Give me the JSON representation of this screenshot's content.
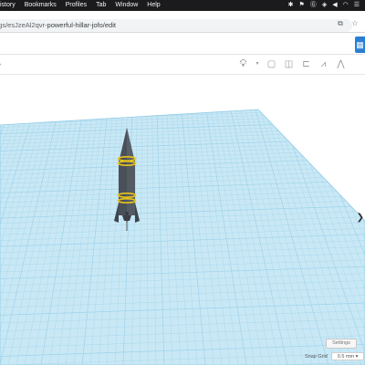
{
  "menubar": {
    "items": [
      "istory",
      "Bookmarks",
      "Profiles",
      "Tab",
      "Window",
      "Help"
    ],
    "status_icons": [
      "bluetooth-icon",
      "flag-icon",
      "g-icon",
      "shield-icon",
      "volume-icon",
      "wifi-icon",
      "control-center-icon"
    ]
  },
  "addressbar": {
    "url_prefix": "ngs/esJzeAl2qvr-",
    "url_path": "powerful-hillar-jofo/edit"
  },
  "toolbar": {
    "tools": [
      "lightbulb-icon",
      "copy-icon",
      "duplicate-icon",
      "align-icon",
      "mirror-icon",
      "group-icon"
    ]
  },
  "workplane": {
    "settings_label": "Settings",
    "snap_label": "Snap Grid",
    "snap_value": "0.5 mm"
  },
  "colors": {
    "grid_fill": "#c9e8f5",
    "grid_line": "#9fd3ea",
    "rocket_body": "#4a5058",
    "rocket_band": "#e8c51a",
    "accent": "#2a7fd4"
  }
}
